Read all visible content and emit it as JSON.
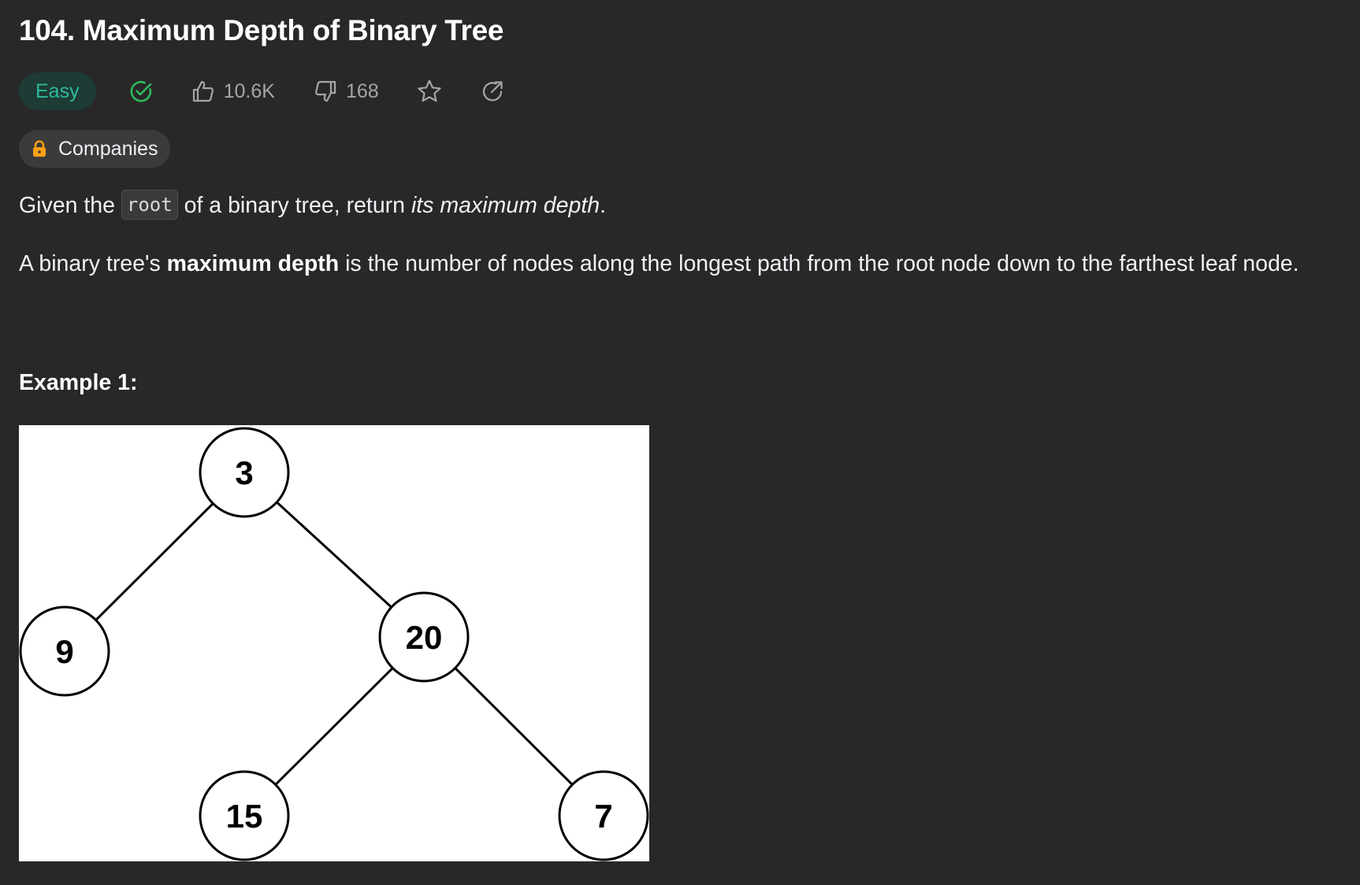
{
  "problem": {
    "title": "104. Maximum Depth of Binary Tree",
    "difficulty": "Easy",
    "likes": "10.6K",
    "dislikes": "168",
    "companies_label": "Companies",
    "description": {
      "p1_prefix": "Given the ",
      "p1_code": "root",
      "p1_middle": " of a binary tree, return ",
      "p1_emphasis": "its maximum depth",
      "p1_suffix": ".",
      "p2_prefix": "A binary tree's ",
      "p2_bold": "maximum depth",
      "p2_suffix": " is the number of nodes along the longest path from the root node down to the farthest leaf node."
    },
    "example1_heading": "Example 1:"
  },
  "tree": {
    "nodes": [
      {
        "id": "n3",
        "label": "3"
      },
      {
        "id": "n9",
        "label": "9"
      },
      {
        "id": "n20",
        "label": "20"
      },
      {
        "id": "n15",
        "label": "15"
      },
      {
        "id": "n7",
        "label": "7"
      }
    ],
    "edges": [
      [
        "n3",
        "n9"
      ],
      [
        "n3",
        "n20"
      ],
      [
        "n20",
        "n15"
      ],
      [
        "n20",
        "n7"
      ]
    ]
  },
  "colors": {
    "background": "#282828",
    "easy_badge_bg": "#1e3b36",
    "easy_badge_text": "#2cbb9d",
    "solved_check": "#2cbb5d",
    "muted_text": "#a6a6a6",
    "lock_orange": "#ffa116"
  },
  "icons": {
    "solved": "check-circle-icon",
    "likes": "thumbs-up-icon",
    "dislikes": "thumbs-down-icon",
    "favorite": "star-icon",
    "share": "share-icon",
    "companies": "lock-icon"
  }
}
